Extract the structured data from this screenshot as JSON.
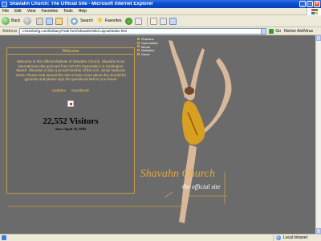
{
  "window": {
    "title": "Shavahn Church: The Official Site - Microsoft Internet Explorer",
    "minimize": "_",
    "maximize": "□",
    "close": "×"
  },
  "menu": [
    "File",
    "Edit",
    "View",
    "Favorites",
    "Tools",
    "Help"
  ],
  "toolbar": {
    "back": "Back",
    "search": "Search",
    "favorites": "Favorites"
  },
  "address": {
    "label": "Address",
    "url": "J:\\Hanhui\\g.com\\brittany\\Trak form\\shavahn\\Old Layout\\index.htm",
    "go": "Go",
    "links": "Norton AntiVirus"
  },
  "panel": {
    "header": "Welcome",
    "text": "Welcome to the Official Website of Shavahn Church. Shavahn is an international elite gymnast from SCATS Gymnastics in Huntington Beach. Shavahn is also a proud member of the U.S. Junior National Team. Please look around the site to learn more about this wonderful gymnast and please sign the guestbook before you leave!",
    "link_updates": "Updates",
    "link_guestbook": "Guestbook",
    "visitors": "22,552 Visitors",
    "since": "Since April 19, 2003"
  },
  "nav": [
    "Shavahn",
    "Gymnastics",
    "Media",
    "Websites",
    "Home"
  ],
  "brand": {
    "name": "Shavahn Church",
    "tagline": "the official site"
  },
  "status": {
    "text": "",
    "zone": "Local intranet"
  },
  "colors": {
    "page_bg": "#6b6b6b",
    "accent_gold": "#e6a83b",
    "leotard": "#d8a020"
  }
}
